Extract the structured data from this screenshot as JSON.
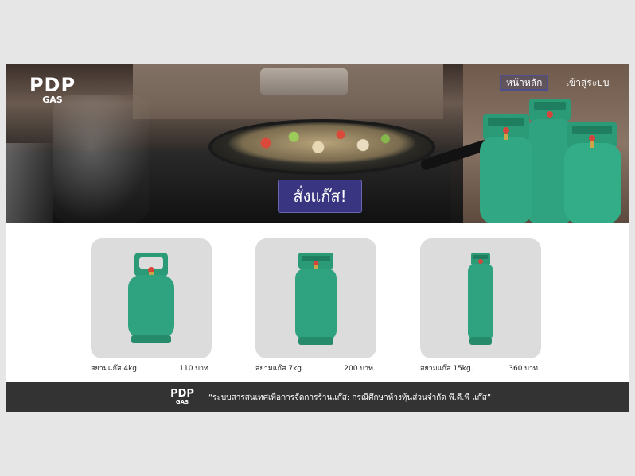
{
  "brand": {
    "name": "PDP",
    "sub": "GAS"
  },
  "nav": {
    "home_label": "หน้าหลัก",
    "login_label": "เข้าสู่ระบบ"
  },
  "hero": {
    "order_label": "สั่งแก๊ส!"
  },
  "products": [
    {
      "name": "สยามแก๊ส 4kg.",
      "price": "110 บาท"
    },
    {
      "name": "สยามแก๊ส 7kg.",
      "price": "200 บาท"
    },
    {
      "name": "สยามแก๊ส 15kg.",
      "price": "360 บาท"
    }
  ],
  "footer": {
    "brand_name": "PDP",
    "brand_sub": "GAS",
    "tagline": "“ระบบสารสนเทศเพื่อการจัดการร้านแก๊ส: กรณีศึกษาห้างหุ้นส่วนจำกัด พี.ดี.พี แก๊ส”"
  },
  "colors": {
    "tank_green": "#2fa37f",
    "order_button": "#3a3580",
    "footer_bg": "#333333",
    "card_bg": "#dcdcdc"
  }
}
